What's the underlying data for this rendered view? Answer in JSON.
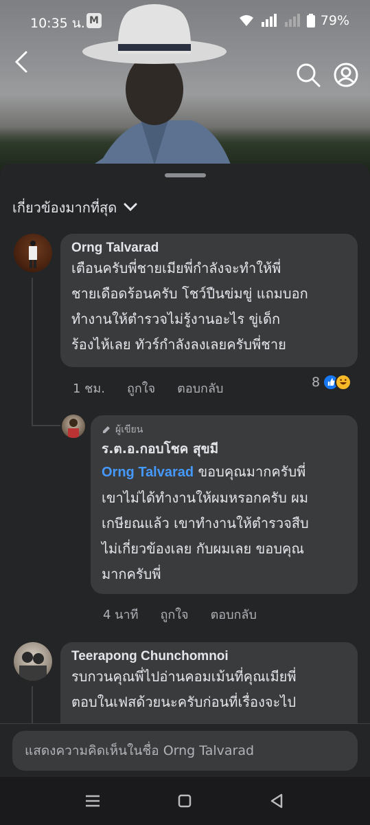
{
  "status_bar": {
    "time": "10:35 น.",
    "notif_badge": "M",
    "battery": "79%"
  },
  "sort": {
    "label": "เกี่ยวข้องมากที่สุด"
  },
  "comments": [
    {
      "name": "Orng Talvarad",
      "text": [
        "เตือนครับพี่ชายเมียพี่กำลังจะทำให้พี่",
        "ชายเดือดร้อนครับ โชว์ปืนข่มขู่ แถมบอก",
        "ทำงานให้ตำรวจไม่รู้งานอะไร ขู่เด็ก",
        "ร้องไห้เลย ทัวร์กำลังลงเลยครับพี่ชาย"
      ],
      "time": "1 ชม.",
      "like": "ถูกใจ",
      "reply": "ตอบกลับ",
      "reaction_count": "8"
    },
    {
      "author_tag": "ผู้เขียน",
      "name": "ร.ต.อ.กอบโชค สุขมี",
      "mention": "Orng Talvarad",
      "first_line_rest": " ขอบคุณมากครับพี่",
      "text": [
        "เขาไม่ได้ทำงานให้ผมหรอกครับ ผม",
        "เกษียณแล้ว เขาทำงานให้ตำรวจสืบ",
        "ไม่เกี่ยวข้องเลย กับผมเลย ขอบคุณ",
        "มากครับพี่"
      ],
      "time": "4 นาที",
      "like": "ถูกใจ",
      "reply": "ตอบกลับ"
    },
    {
      "name": "Teerapong Chunchomnoi",
      "text": [
        "รบกวนคุณพี่ไปอ่านคอมเม้นที่คุณเมียพี่",
        "ตอบในเฟสด้วยนะครับก่อนที่เรื่องจะไป"
      ]
    }
  ],
  "composer": {
    "placeholder": "แสดงความคิดเห็นในชื่อ Orng Talvarad"
  },
  "colors": {
    "background": "#242526",
    "bubble": "#3a3b3c",
    "mention": "#4599ff",
    "like": "#1877f2",
    "haha": "#f7b928"
  }
}
